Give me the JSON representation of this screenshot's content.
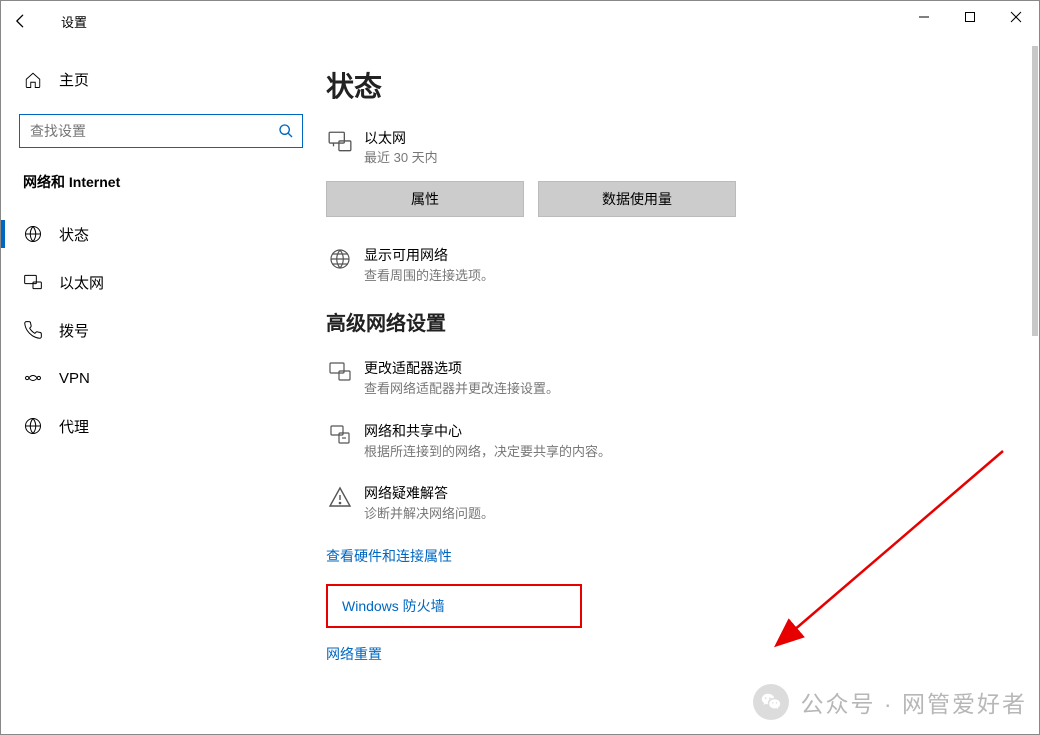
{
  "window": {
    "title": "设置"
  },
  "sidebar": {
    "home_label": "主页",
    "search_placeholder": "查找设置",
    "category": "网络和 Internet",
    "items": [
      {
        "label": "状态"
      },
      {
        "label": "以太网"
      },
      {
        "label": "拨号"
      },
      {
        "label": "VPN"
      },
      {
        "label": "代理"
      }
    ]
  },
  "page": {
    "title": "状态",
    "ethernet": {
      "title": "以太网",
      "subtitle": "最近 30 天内"
    },
    "buttons": {
      "properties": "属性",
      "data_usage": "数据使用量"
    },
    "available_networks": {
      "title": "显示可用网络",
      "subtitle": "查看周围的连接选项。"
    },
    "advanced_heading": "高级网络设置",
    "adapter_options": {
      "title": "更改适配器选项",
      "subtitle": "查看网络适配器并更改连接设置。"
    },
    "sharing_center": {
      "title": "网络和共享中心",
      "subtitle": "根据所连接到的网络，决定要共享的内容。"
    },
    "troubleshoot": {
      "title": "网络疑难解答",
      "subtitle": "诊断并解决网络问题。"
    },
    "links": {
      "hardware": "查看硬件和连接属性",
      "firewall": "Windows 防火墙",
      "reset": "网络重置"
    }
  },
  "watermark": {
    "text": "公众号 · 网管爱好者"
  }
}
